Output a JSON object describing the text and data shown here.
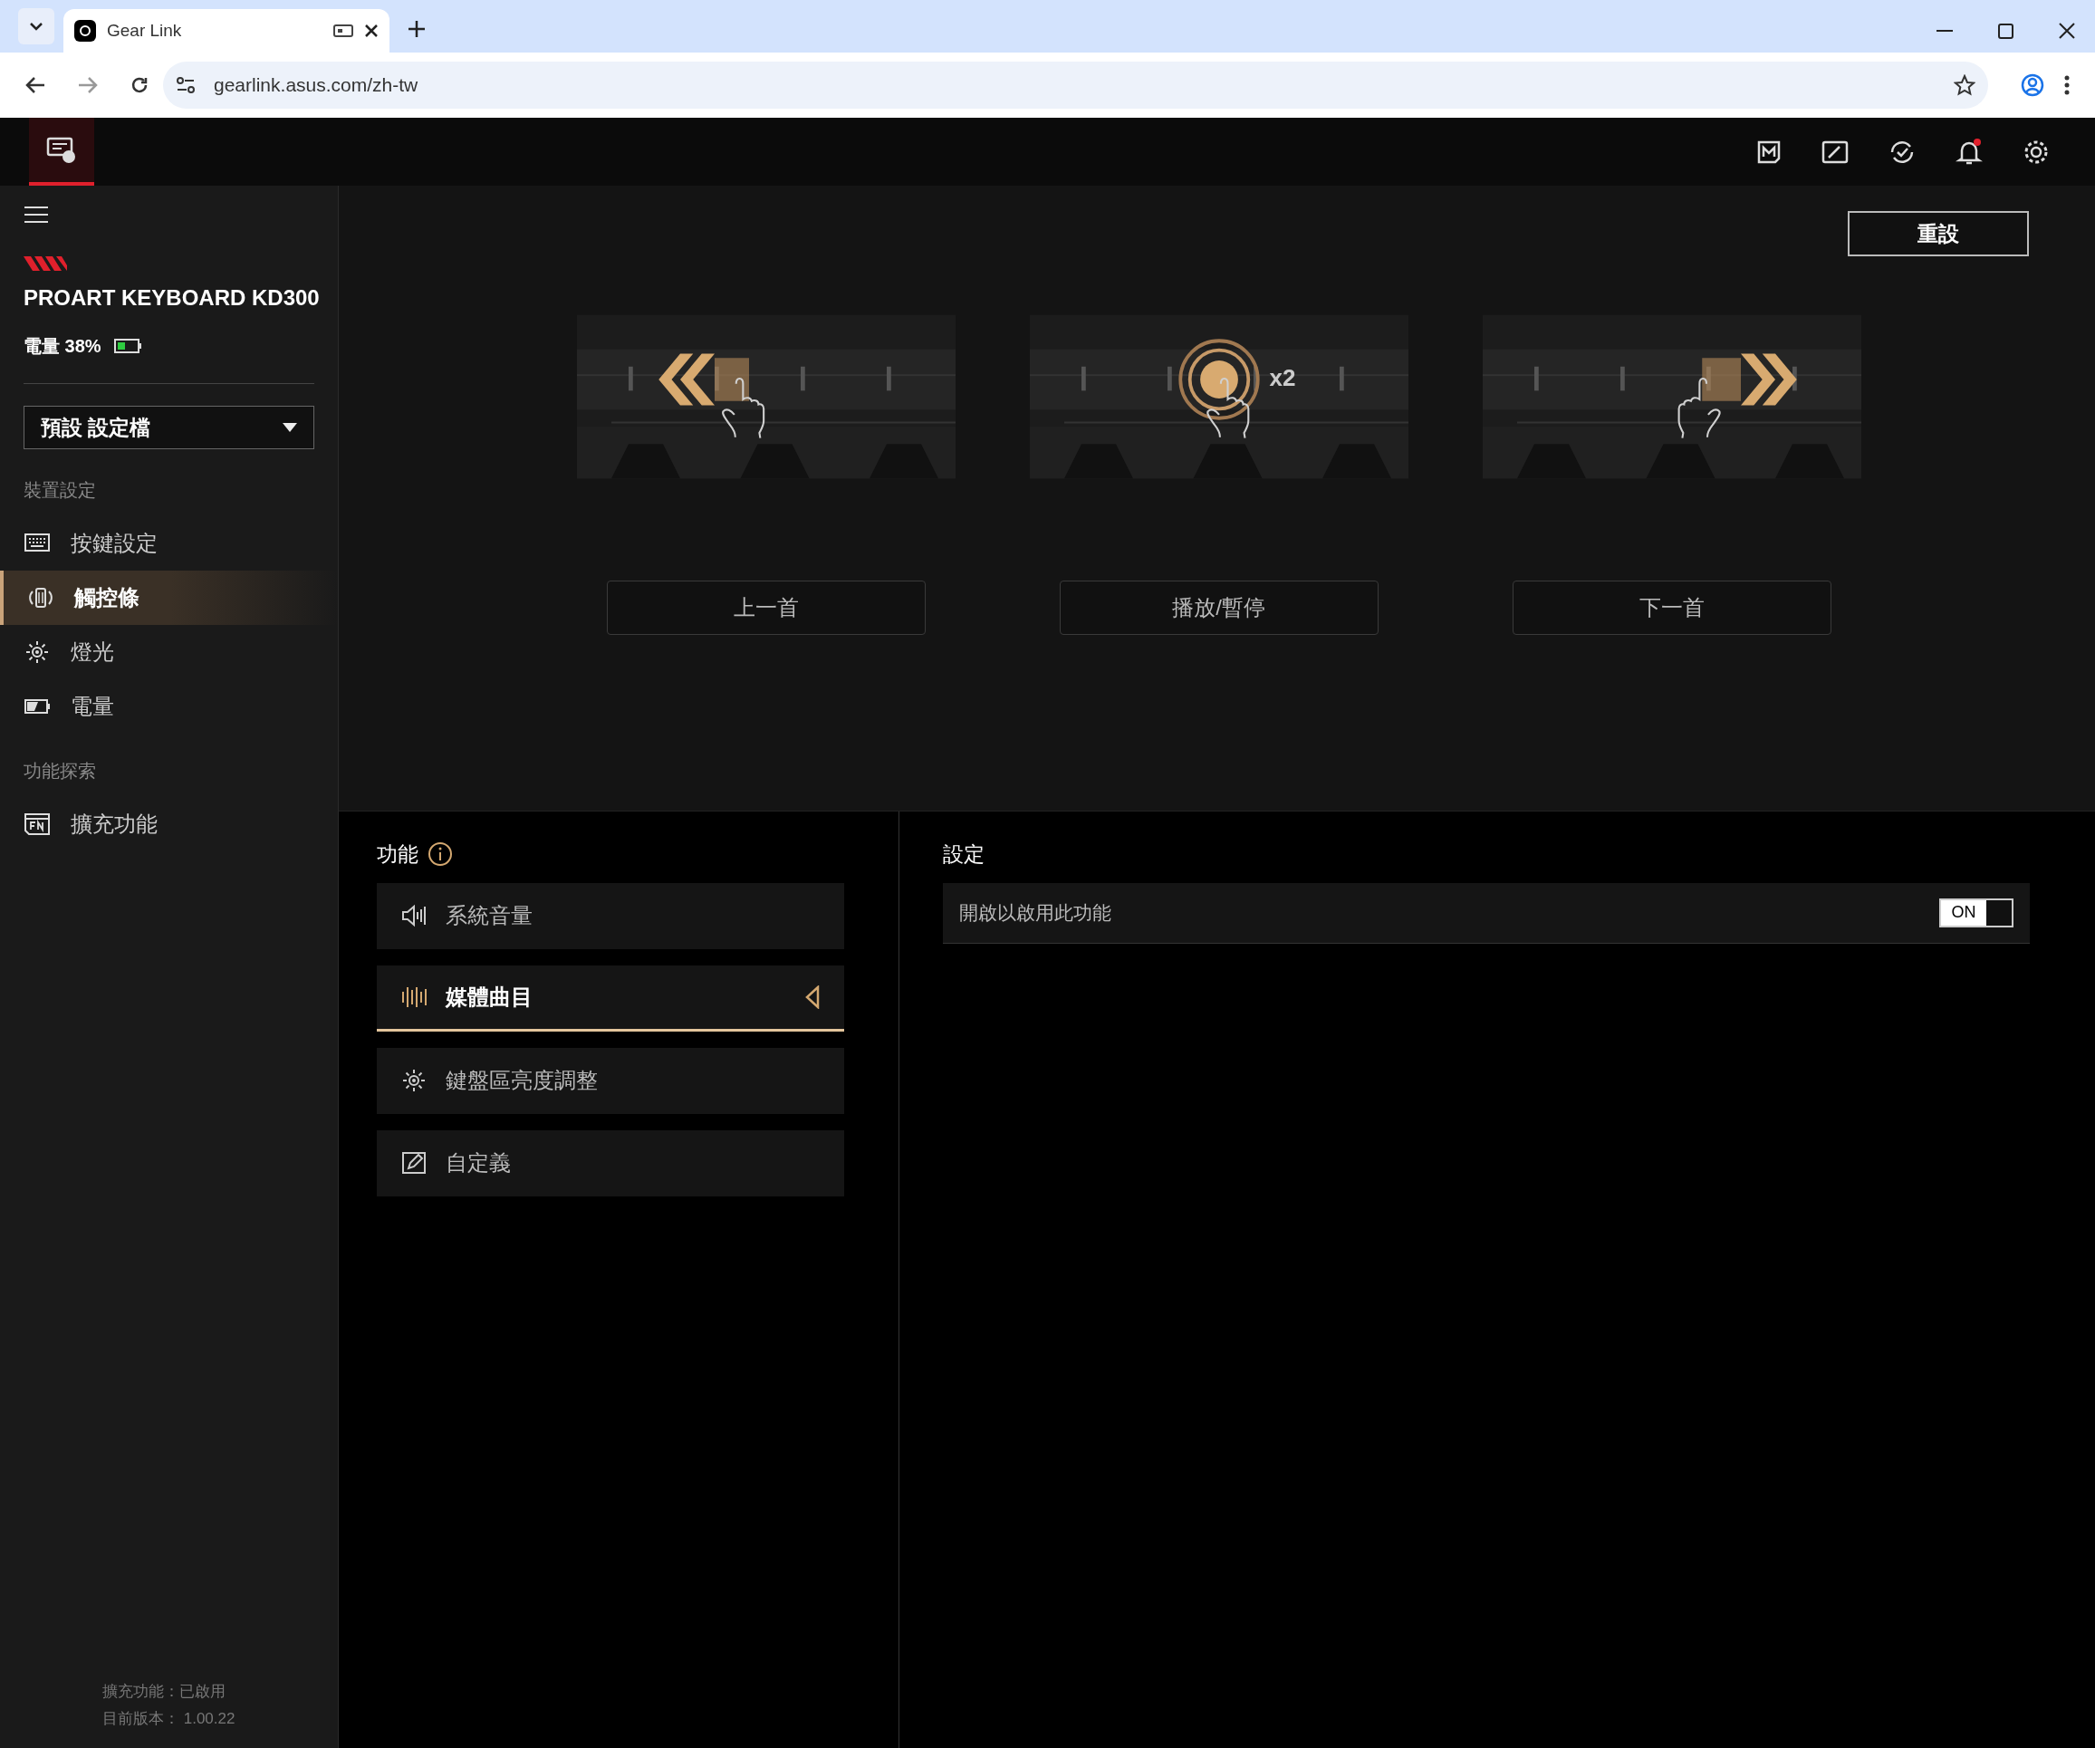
{
  "browser": {
    "tab_title": "Gear Link",
    "url": "gearlink.asus.com/zh-tw"
  },
  "sidebar": {
    "device_name": "PROART KEYBOARD KD300",
    "battery": "電量 38%",
    "profile": "預設 設定檔",
    "sections": [
      {
        "title": "裝置設定",
        "items": [
          {
            "label": "按鍵設定",
            "kind": "keyboard",
            "selected": false
          },
          {
            "label": "觸控條",
            "kind": "touchbar",
            "selected": true
          },
          {
            "label": "燈光",
            "kind": "light",
            "selected": false
          },
          {
            "label": "電量",
            "kind": "battery",
            "selected": false
          }
        ]
      },
      {
        "title": "功能探索",
        "items": [
          {
            "label": "擴充功能",
            "kind": "fn",
            "selected": false
          }
        ]
      }
    ],
    "footer": [
      "擴充功能：已啟用",
      "目前版本： 1.00.22"
    ]
  },
  "reset_button": "重設",
  "gestures": [
    {
      "kind": "swipe-left",
      "label": "上一首"
    },
    {
      "kind": "double-tap",
      "tap_count": "x2",
      "label": "播放/暫停"
    },
    {
      "kind": "swipe-right",
      "label": "下一首"
    }
  ],
  "functions": {
    "title": "功能",
    "items": [
      {
        "label": "系統音量",
        "kind": "volume",
        "selected": false
      },
      {
        "label": "媒體曲目",
        "kind": "media",
        "selected": true
      },
      {
        "label": "鍵盤區亮度調整",
        "kind": "light",
        "selected": false
      },
      {
        "label": "自定義",
        "kind": "custom",
        "selected": false
      }
    ]
  },
  "settings": {
    "title": "設定",
    "rows": [
      {
        "label": "開啟以啟用此功能",
        "on": true,
        "toggle_text": "ON"
      }
    ]
  }
}
